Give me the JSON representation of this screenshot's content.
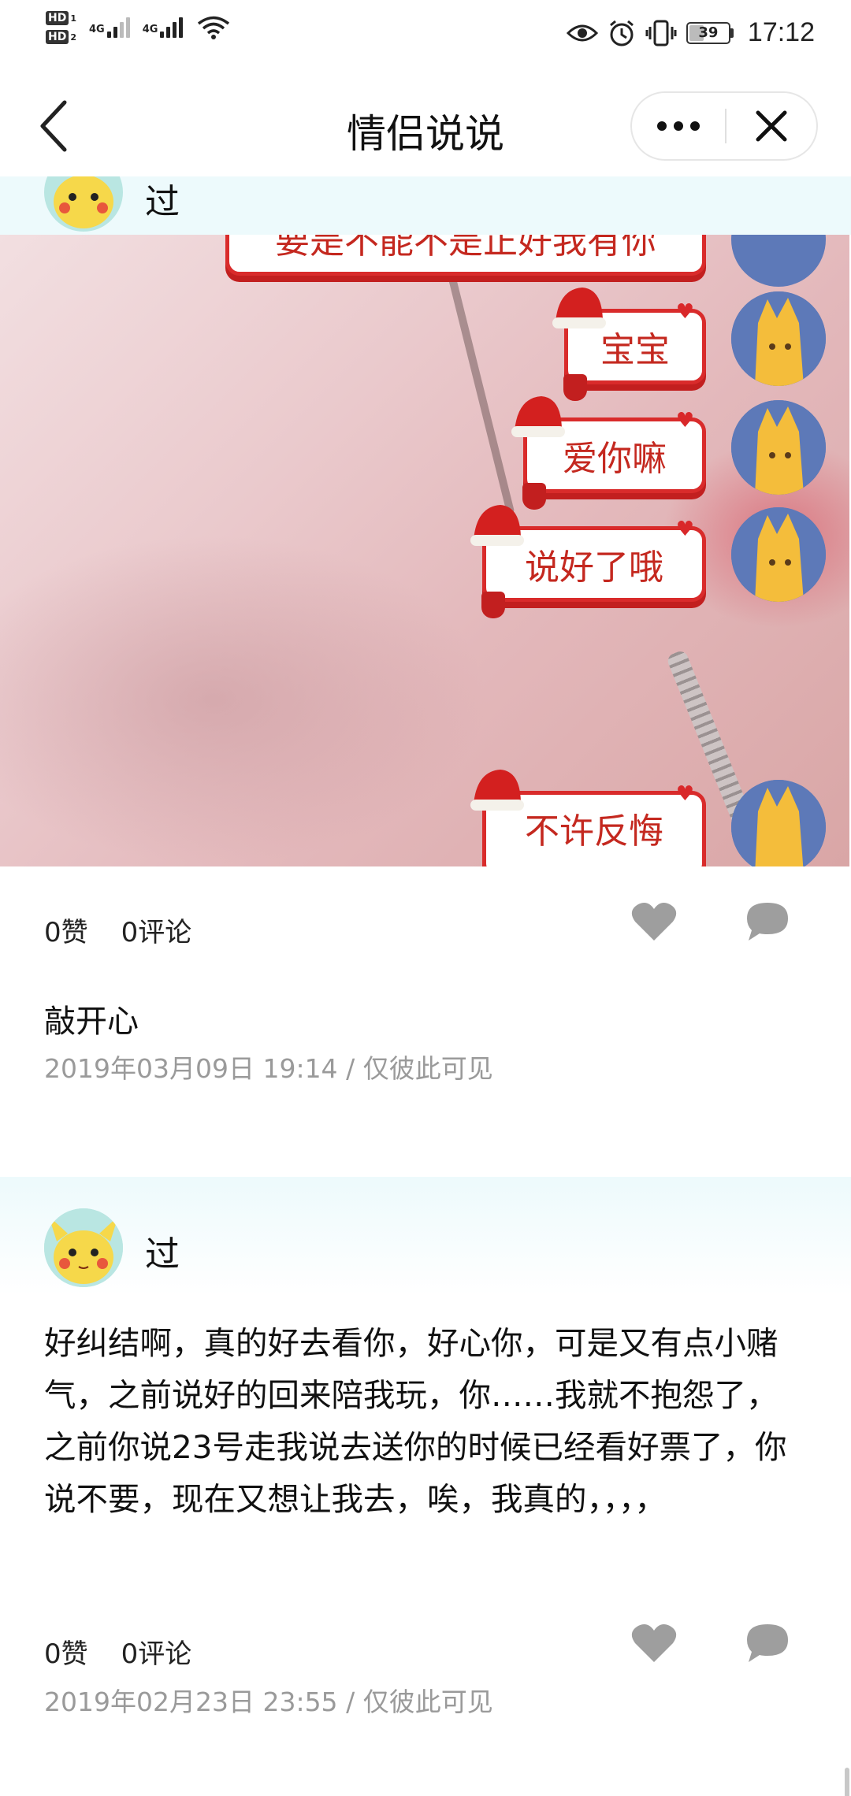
{
  "status_bar": {
    "hd1": "HD",
    "hd1_sub": "1",
    "hd2": "HD",
    "hd2_sub": "2",
    "net1": "4G",
    "net2": "4G",
    "battery": "39",
    "time": "17:12",
    "icons": [
      "eye-icon",
      "alarm-icon",
      "vibrate-icon",
      "wifi-icon",
      "signal-icon"
    ]
  },
  "nav": {
    "title": "情侣说说",
    "icons": [
      "back-icon",
      "more-icon",
      "close-icon"
    ]
  },
  "posts": [
    {
      "author": "过",
      "chat_bubbles": [
        "要是不能不是正好我有你",
        "宝宝",
        "爱你嘛",
        "说好了哦",
        "不许反悔"
      ],
      "likes": "0赞",
      "comments": "0评论",
      "caption": "敲开心",
      "date": "2019年03月09日 19:14",
      "separator": "/",
      "visibility": "仅彼此可见"
    },
    {
      "author": "过",
      "text": "好纠结啊，真的好去看你，好心你，可是又有点小赌气，之前说好的回来陪我玩，你……我就不抱怨了，之前你说23号走我说去送你的时候已经看好票了，你说不要，现在又想让我去，唉，我真的，，，，",
      "likes": "0赞",
      "comments": "0评论",
      "date": "2019年02月23日 23:55",
      "separator": "/",
      "visibility": "仅彼此可见"
    }
  ],
  "colors": {
    "header_bg": "#edfafc",
    "bubble_red": "#d92b2b",
    "icon_gray": "#9e9e9e",
    "meta_gray": "#9a9a9a"
  }
}
